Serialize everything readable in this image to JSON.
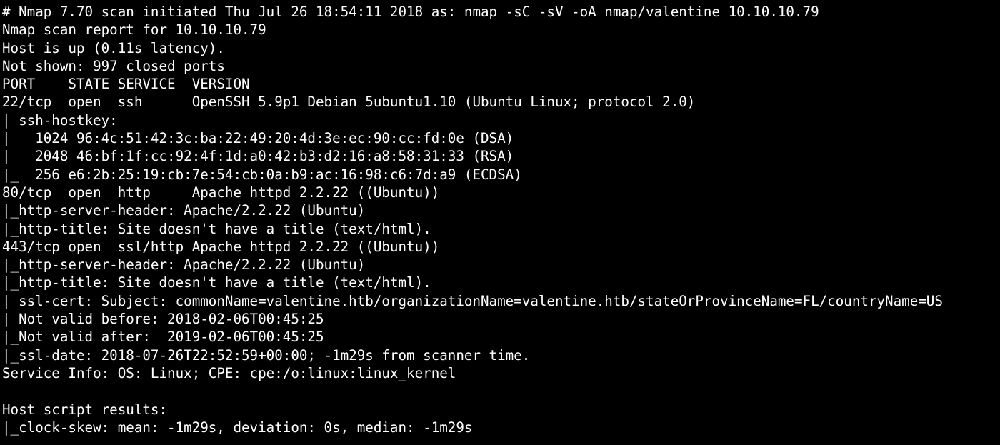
{
  "terminal": {
    "lines": [
      "# Nmap 7.70 scan initiated Thu Jul 26 18:54:11 2018 as: nmap -sC -sV -oA nmap/valentine 10.10.10.79",
      "Nmap scan report for 10.10.10.79",
      "Host is up (0.11s latency).",
      "Not shown: 997 closed ports",
      "PORT    STATE SERVICE  VERSION",
      "22/tcp  open  ssh      OpenSSH 5.9p1 Debian 5ubuntu1.10 (Ubuntu Linux; protocol 2.0)",
      "| ssh-hostkey:",
      "|   1024 96:4c:51:42:3c:ba:22:49:20:4d:3e:ec:90:cc:fd:0e (DSA)",
      "|   2048 46:bf:1f:cc:92:4f:1d:a0:42:b3:d2:16:a8:58:31:33 (RSA)",
      "|_  256 e6:2b:25:19:cb:7e:54:cb:0a:b9:ac:16:98:c6:7d:a9 (ECDSA)",
      "80/tcp  open  http     Apache httpd 2.2.22 ((Ubuntu))",
      "|_http-server-header: Apache/2.2.22 (Ubuntu)",
      "|_http-title: Site doesn't have a title (text/html).",
      "443/tcp open  ssl/http Apache httpd 2.2.22 ((Ubuntu))",
      "|_http-server-header: Apache/2.2.22 (Ubuntu)",
      "|_http-title: Site doesn't have a title (text/html).",
      "| ssl-cert: Subject: commonName=valentine.htb/organizationName=valentine.htb/stateOrProvinceName=FL/countryName=US",
      "| Not valid before: 2018-02-06T00:45:25",
      "|_Not valid after:  2019-02-06T00:45:25",
      "|_ssl-date: 2018-07-26T22:52:59+00:00; -1m29s from scanner time.",
      "Service Info: OS: Linux; CPE: cpe:/o:linux:linux_kernel",
      "",
      "Host script results:",
      "|_clock-skew: mean: -1m29s, deviation: 0s, median: -1m29s"
    ]
  }
}
